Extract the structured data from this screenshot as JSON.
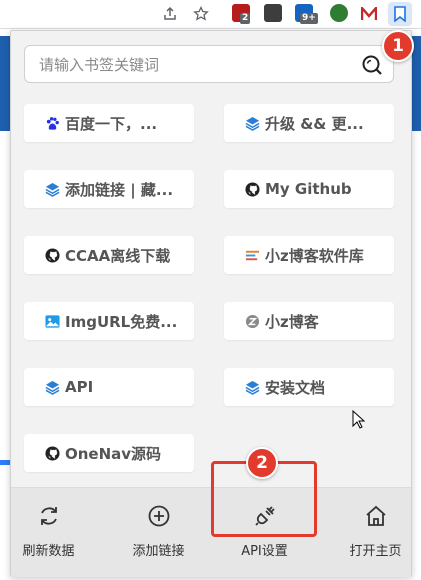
{
  "toolbar": {
    "badges": [
      "2",
      "9+"
    ]
  },
  "search": {
    "placeholder": "请输入书签关键词"
  },
  "bookmarks": [
    {
      "label": "百度一下，...",
      "icon": "baidu-icon"
    },
    {
      "label": "升级 && 更...",
      "icon": "layers-icon"
    },
    {
      "label": "添加链接 | 藏...",
      "icon": "layers-icon"
    },
    {
      "label": "My Github",
      "icon": "github-icon"
    },
    {
      "label": "CCAA离线下载",
      "icon": "github-icon"
    },
    {
      "label": "小z博客软件库",
      "icon": "list-icon"
    },
    {
      "label": "ImgURL免费...",
      "icon": "image-icon"
    },
    {
      "label": "小z博客",
      "icon": "z-icon"
    },
    {
      "label": "API",
      "icon": "layers-icon"
    },
    {
      "label": "安装文档",
      "icon": "layers-icon"
    },
    {
      "label": "OneNav源码",
      "icon": "github-icon"
    }
  ],
  "actions": {
    "refresh": "刷新数据",
    "add": "添加链接",
    "api": "API设置",
    "home": "打开主页"
  },
  "markers": [
    "1",
    "2"
  ],
  "colors": {
    "marker": "#e23b2e",
    "layers_icon": "#2a7fd4"
  }
}
